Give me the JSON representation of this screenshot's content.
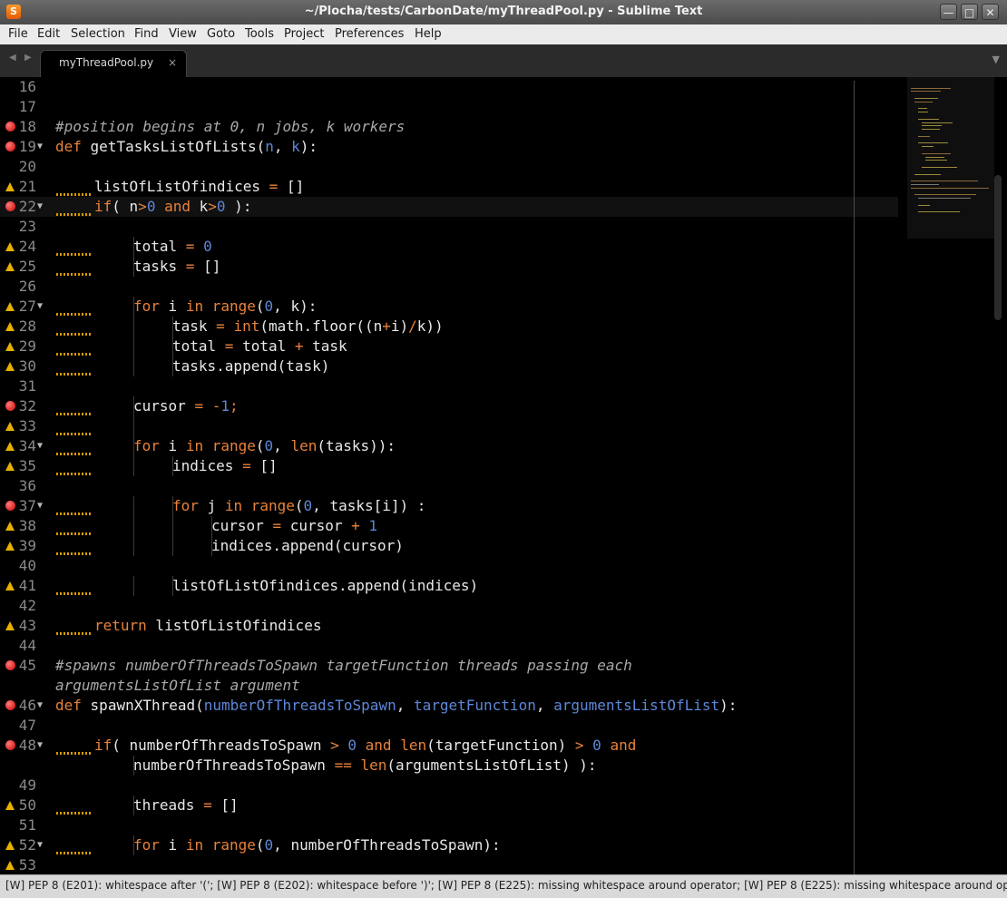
{
  "window": {
    "title": "~/Plocha/tests/CarbonDate/myThreadPool.py - Sublime Text",
    "app_icon_glyph": "S",
    "minimize_glyph": "—",
    "maximize_glyph": "□",
    "close_glyph": "✕"
  },
  "menu": [
    "File",
    "Edit",
    "Selection",
    "Find",
    "View",
    "Goto",
    "Tools",
    "Project",
    "Preferences",
    "Help"
  ],
  "tabs": {
    "back_glyph": "◀",
    "forward_glyph": "▶",
    "items": [
      {
        "label": "myThreadPool.py",
        "close_glyph": "×"
      }
    ],
    "dropdown_glyph": "▼"
  },
  "colors": {
    "background": "#000000",
    "text": "#e8e8e8",
    "comment": "#a8a8a8",
    "keyword": "#e8823a",
    "builtin": "#e8823a",
    "number": "#5e87d8",
    "param": "#5e87d8",
    "operator": "#e8823a",
    "error_marker": "#c80000",
    "warning_marker": "#e8b000"
  },
  "code": {
    "lines": [
      {
        "num": "16",
        "marker": "",
        "fold": false,
        "tokens": []
      },
      {
        "num": "17",
        "marker": "",
        "fold": false,
        "tokens": []
      },
      {
        "num": "18",
        "marker": "error",
        "fold": false,
        "tokens": [
          {
            "t": "#position begins at 0, n jobs, k workers",
            "c": "comment"
          }
        ]
      },
      {
        "num": "19",
        "marker": "error",
        "fold": true,
        "tokens": [
          {
            "t": "def",
            "c": "keyword"
          },
          {
            "t": " ",
            "c": "text"
          },
          {
            "t": "getTasksListOfLists",
            "c": "def"
          },
          {
            "t": "(",
            "c": "text"
          },
          {
            "t": "n",
            "c": "param"
          },
          {
            "t": ", ",
            "c": "text"
          },
          {
            "t": "k",
            "c": "param"
          },
          {
            "t": "):",
            "c": "text"
          }
        ]
      },
      {
        "num": "20",
        "marker": "",
        "fold": false,
        "tokens": []
      },
      {
        "num": "21",
        "marker": "warn",
        "fold": false,
        "indent": 1,
        "tokens": [
          {
            "t": "listOfListOfindices ",
            "c": "text"
          },
          {
            "t": "=",
            "c": "operator"
          },
          {
            "t": " []",
            "c": "text"
          }
        ]
      },
      {
        "num": "22",
        "marker": "error",
        "fold": true,
        "indent": 1,
        "current": true,
        "tokens": [
          {
            "t": "if",
            "c": "keyword"
          },
          {
            "t": "( n",
            "c": "text"
          },
          {
            "t": ">",
            "c": "operator"
          },
          {
            "t": "0",
            "c": "number"
          },
          {
            "t": " ",
            "c": "text"
          },
          {
            "t": "and",
            "c": "keyword"
          },
          {
            "t": " k",
            "c": "text"
          },
          {
            "t": ">",
            "c": "operator"
          },
          {
            "t": "0",
            "c": "number"
          },
          {
            "t": " ):",
            "c": "text"
          }
        ]
      },
      {
        "num": "23",
        "marker": "",
        "fold": false,
        "tokens": []
      },
      {
        "num": "24",
        "marker": "warn",
        "fold": false,
        "indent": 2,
        "tokens": [
          {
            "t": "total ",
            "c": "text"
          },
          {
            "t": "=",
            "c": "operator"
          },
          {
            "t": " ",
            "c": "text"
          },
          {
            "t": "0",
            "c": "number"
          }
        ]
      },
      {
        "num": "25",
        "marker": "warn",
        "fold": false,
        "indent": 2,
        "tokens": [
          {
            "t": "tasks ",
            "c": "text"
          },
          {
            "t": "=",
            "c": "operator"
          },
          {
            "t": " []",
            "c": "text"
          }
        ]
      },
      {
        "num": "26",
        "marker": "",
        "fold": false,
        "tokens": []
      },
      {
        "num": "27",
        "marker": "warn",
        "fold": true,
        "indent": 2,
        "tokens": [
          {
            "t": "for",
            "c": "keyword"
          },
          {
            "t": " i ",
            "c": "text"
          },
          {
            "t": "in",
            "c": "keyword"
          },
          {
            "t": " ",
            "c": "text"
          },
          {
            "t": "range",
            "c": "builtin"
          },
          {
            "t": "(",
            "c": "text"
          },
          {
            "t": "0",
            "c": "number"
          },
          {
            "t": ", k):",
            "c": "text"
          }
        ]
      },
      {
        "num": "28",
        "marker": "warn",
        "fold": false,
        "indent": 3,
        "tokens": [
          {
            "t": "task ",
            "c": "text"
          },
          {
            "t": "=",
            "c": "operator"
          },
          {
            "t": " ",
            "c": "text"
          },
          {
            "t": "int",
            "c": "builtin"
          },
          {
            "t": "(math.floor((n",
            "c": "text"
          },
          {
            "t": "+",
            "c": "operator"
          },
          {
            "t": "i)",
            "c": "text"
          },
          {
            "t": "/",
            "c": "operator"
          },
          {
            "t": "k))",
            "c": "text"
          }
        ]
      },
      {
        "num": "29",
        "marker": "warn",
        "fold": false,
        "indent": 3,
        "tokens": [
          {
            "t": "total ",
            "c": "text"
          },
          {
            "t": "=",
            "c": "operator"
          },
          {
            "t": " total ",
            "c": "text"
          },
          {
            "t": "+",
            "c": "operator"
          },
          {
            "t": " task",
            "c": "text"
          }
        ]
      },
      {
        "num": "30",
        "marker": "warn",
        "fold": false,
        "indent": 3,
        "tokens": [
          {
            "t": "tasks.append(task)",
            "c": "text"
          }
        ]
      },
      {
        "num": "31",
        "marker": "",
        "fold": false,
        "tokens": []
      },
      {
        "num": "32",
        "marker": "error",
        "fold": false,
        "indent": 2,
        "tokens": [
          {
            "t": "cursor ",
            "c": "text"
          },
          {
            "t": "=",
            "c": "operator"
          },
          {
            "t": " ",
            "c": "text"
          },
          {
            "t": "-",
            "c": "operator"
          },
          {
            "t": "1",
            "c": "number"
          },
          {
            "t": ";",
            "c": "operator"
          }
        ]
      },
      {
        "num": "33",
        "marker": "warn",
        "fold": false,
        "indent": 2,
        "tokens": []
      },
      {
        "num": "34",
        "marker": "warn",
        "fold": true,
        "indent": 2,
        "tokens": [
          {
            "t": "for",
            "c": "keyword"
          },
          {
            "t": " i ",
            "c": "text"
          },
          {
            "t": "in",
            "c": "keyword"
          },
          {
            "t": " ",
            "c": "text"
          },
          {
            "t": "range",
            "c": "builtin"
          },
          {
            "t": "(",
            "c": "text"
          },
          {
            "t": "0",
            "c": "number"
          },
          {
            "t": ", ",
            "c": "text"
          },
          {
            "t": "len",
            "c": "builtin"
          },
          {
            "t": "(tasks)):",
            "c": "text"
          }
        ]
      },
      {
        "num": "35",
        "marker": "warn",
        "fold": false,
        "indent": 3,
        "tokens": [
          {
            "t": "indices ",
            "c": "text"
          },
          {
            "t": "=",
            "c": "operator"
          },
          {
            "t": " []",
            "c": "text"
          }
        ]
      },
      {
        "num": "36",
        "marker": "",
        "fold": false,
        "tokens": []
      },
      {
        "num": "37",
        "marker": "error",
        "fold": true,
        "indent": 3,
        "tokens": [
          {
            "t": "for",
            "c": "keyword"
          },
          {
            "t": " j ",
            "c": "text"
          },
          {
            "t": "in",
            "c": "keyword"
          },
          {
            "t": " ",
            "c": "text"
          },
          {
            "t": "range",
            "c": "builtin"
          },
          {
            "t": "(",
            "c": "text"
          },
          {
            "t": "0",
            "c": "number"
          },
          {
            "t": ", tasks[i]) :",
            "c": "text"
          }
        ]
      },
      {
        "num": "38",
        "marker": "warn",
        "fold": false,
        "indent": 4,
        "tokens": [
          {
            "t": "cursor ",
            "c": "text"
          },
          {
            "t": "=",
            "c": "operator"
          },
          {
            "t": " cursor ",
            "c": "text"
          },
          {
            "t": "+",
            "c": "operator"
          },
          {
            "t": " ",
            "c": "text"
          },
          {
            "t": "1",
            "c": "number"
          }
        ]
      },
      {
        "num": "39",
        "marker": "warn",
        "fold": false,
        "indent": 4,
        "tokens": [
          {
            "t": "indices.append(cursor)",
            "c": "text"
          }
        ]
      },
      {
        "num": "40",
        "marker": "",
        "fold": false,
        "tokens": []
      },
      {
        "num": "41",
        "marker": "warn",
        "fold": false,
        "indent": 3,
        "tokens": [
          {
            "t": "listOfListOfindices.append(indices)",
            "c": "text"
          }
        ]
      },
      {
        "num": "42",
        "marker": "",
        "fold": false,
        "tokens": []
      },
      {
        "num": "43",
        "marker": "warn",
        "fold": false,
        "indent": 1,
        "tokens": [
          {
            "t": "return",
            "c": "keyword"
          },
          {
            "t": " listOfListOfindices",
            "c": "text"
          }
        ]
      },
      {
        "num": "44",
        "marker": "",
        "fold": false,
        "tokens": []
      },
      {
        "num": "45",
        "marker": "error",
        "fold": false,
        "tokens": [
          {
            "t": "#spawns numberOfThreadsToSpawn targetFunction threads passing each ",
            "c": "comment"
          }
        ]
      },
      {
        "num": "",
        "marker": "",
        "fold": false,
        "tokens": [
          {
            "t": "argumentsListOfList argument",
            "c": "comment"
          }
        ]
      },
      {
        "num": "46",
        "marker": "error",
        "fold": true,
        "tokens": [
          {
            "t": "def",
            "c": "keyword"
          },
          {
            "t": " ",
            "c": "text"
          },
          {
            "t": "spawnXThread",
            "c": "def"
          },
          {
            "t": "(",
            "c": "text"
          },
          {
            "t": "numberOfThreadsToSpawn",
            "c": "param"
          },
          {
            "t": ", ",
            "c": "text"
          },
          {
            "t": "targetFunction",
            "c": "param"
          },
          {
            "t": ", ",
            "c": "text"
          },
          {
            "t": "argumentsListOfList",
            "c": "param"
          },
          {
            "t": "):",
            "c": "text"
          }
        ]
      },
      {
        "num": "47",
        "marker": "",
        "fold": false,
        "tokens": []
      },
      {
        "num": "48",
        "marker": "error",
        "fold": true,
        "indent": 1,
        "tokens": [
          {
            "t": "if",
            "c": "keyword"
          },
          {
            "t": "( numberOfThreadsToSpawn ",
            "c": "text"
          },
          {
            "t": ">",
            "c": "operator"
          },
          {
            "t": " ",
            "c": "text"
          },
          {
            "t": "0",
            "c": "number"
          },
          {
            "t": " ",
            "c": "text"
          },
          {
            "t": "and",
            "c": "keyword"
          },
          {
            "t": " ",
            "c": "text"
          },
          {
            "t": "len",
            "c": "builtin"
          },
          {
            "t": "(targetFunction) ",
            "c": "text"
          },
          {
            "t": ">",
            "c": "operator"
          },
          {
            "t": " ",
            "c": "text"
          },
          {
            "t": "0",
            "c": "number"
          },
          {
            "t": " ",
            "c": "text"
          },
          {
            "t": "and",
            "c": "keyword"
          }
        ]
      },
      {
        "num": "",
        "marker": "",
        "fold": false,
        "indent": 2,
        "bare": true,
        "tokens": [
          {
            "t": "numberOfThreadsToSpawn ",
            "c": "text"
          },
          {
            "t": "==",
            "c": "operator"
          },
          {
            "t": " ",
            "c": "text"
          },
          {
            "t": "len",
            "c": "builtin"
          },
          {
            "t": "(argumentsListOfList) ):",
            "c": "text"
          }
        ]
      },
      {
        "num": "49",
        "marker": "",
        "fold": false,
        "tokens": []
      },
      {
        "num": "50",
        "marker": "warn",
        "fold": false,
        "indent": 2,
        "tokens": [
          {
            "t": "threads ",
            "c": "text"
          },
          {
            "t": "=",
            "c": "operator"
          },
          {
            "t": " []",
            "c": "text"
          }
        ]
      },
      {
        "num": "51",
        "marker": "",
        "fold": false,
        "tokens": []
      },
      {
        "num": "52",
        "marker": "warn",
        "fold": true,
        "indent": 2,
        "tokens": [
          {
            "t": "for",
            "c": "keyword"
          },
          {
            "t": " i ",
            "c": "text"
          },
          {
            "t": "in",
            "c": "keyword"
          },
          {
            "t": " ",
            "c": "text"
          },
          {
            "t": "range",
            "c": "builtin"
          },
          {
            "t": "(",
            "c": "text"
          },
          {
            "t": "0",
            "c": "number"
          },
          {
            "t": ", numberOfThreadsToSpawn):",
            "c": "text"
          }
        ]
      },
      {
        "num": "53",
        "marker": "warn",
        "fold": false,
        "tokens": []
      }
    ]
  },
  "status": {
    "text": "[W] PEP 8 (E201): whitespace after '('; [W] PEP 8 (E202): whitespace before ')'; [W] PEP 8 (E225): missing whitespace around operator; [W] PEP 8 (E225): missing whitespace around operator; [V"
  }
}
